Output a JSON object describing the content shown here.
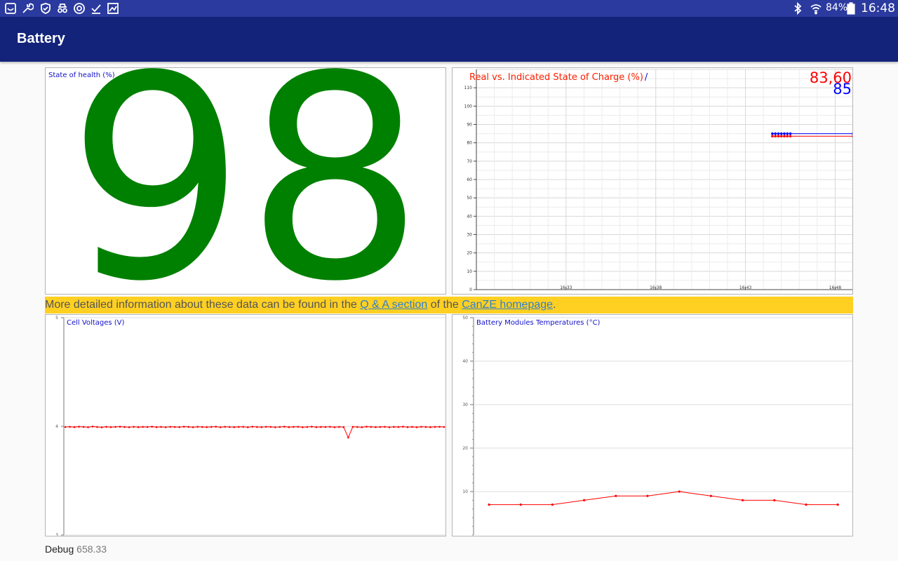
{
  "status_bar": {
    "left_icons": [
      "smile-icon",
      "wrench-icon",
      "shield-icon",
      "spy-icon",
      "sync-icon",
      "check-icon",
      "image-icon"
    ],
    "right_icons": [
      "bluetooth-icon",
      "wifi-icon",
      "battery-icon"
    ],
    "battery_percent": "84%",
    "time": "16:48",
    "color": "#2b3a9e"
  },
  "app_bar": {
    "title": "Battery",
    "color": "#13237a"
  },
  "soh_panel": {
    "title": "State of health (%)",
    "value": "98",
    "value_color": "#008000"
  },
  "soc_panel": {
    "title": "Real vs. Indicated State of Charge (%)",
    "separator": "/",
    "real_value": "83,60",
    "indicated_value": "85",
    "real_color": "#ff0000",
    "indicated_color": "#0000ff"
  },
  "info_bar": {
    "text_before": "More detailed information about these data can be found in the ",
    "link1": "Q & A section",
    "text_middle": " of the ",
    "link2": "CanZE homepage",
    "text_after": ".",
    "color": "#ffd022"
  },
  "cell_panel": {
    "title": "Cell Voltages (V)"
  },
  "temp_panel": {
    "title": "Battery Modules Temperatures (°C)"
  },
  "debug": {
    "label": "Debug",
    "value": "658.33"
  },
  "chart_data": [
    {
      "type": "line",
      "title": "Real vs. Indicated State of Charge (%)",
      "ylim": [
        0,
        120
      ],
      "y_ticks": [
        0,
        10,
        20,
        30,
        40,
        50,
        60,
        70,
        80,
        90,
        100,
        110
      ],
      "x_range": [
        "16:28",
        "16:49"
      ],
      "x_ticks": [
        "16:33",
        "16:38",
        "16:43",
        "16:48"
      ],
      "grid": true,
      "series": [
        {
          "color": "#ff0000",
          "x": [
            "16:44:30",
            "16:44:40",
            "16:44:50",
            "16:45:00",
            "16:45:10",
            "16:45:20",
            "16:45:30",
            "16:49:00"
          ],
          "y": [
            83.6,
            83.6,
            83.6,
            83.6,
            83.6,
            83.6,
            83.6,
            83.6
          ]
        },
        {
          "color": "#0000ff",
          "x": [
            "16:44:30",
            "16:44:40",
            "16:44:50",
            "16:45:00",
            "16:45:10",
            "16:45:20",
            "16:45:30",
            "16:49:00"
          ],
          "y": [
            85,
            85,
            85,
            85,
            85,
            85,
            85,
            85
          ]
        }
      ]
    },
    {
      "type": "line",
      "title": "Cell Voltages (V)",
      "ylim": [
        3,
        5
      ],
      "y_ticks": [
        3,
        4,
        5
      ],
      "grid": true,
      "series": [
        {
          "color": "#ff0000",
          "values": [
            3.994,
            3.996,
            3.993,
            3.997,
            3.995,
            3.992,
            3.998,
            3.994,
            3.991,
            3.996,
            3.993,
            3.995,
            3.997,
            3.994,
            3.992,
            3.996,
            3.993,
            3.995,
            3.994,
            3.997,
            3.993,
            3.995,
            3.992,
            3.996,
            3.994,
            3.993,
            3.997,
            3.995,
            3.992,
            3.996,
            3.994,
            3.993,
            3.995,
            3.997,
            3.992,
            3.996,
            3.994,
            3.993,
            3.995,
            3.996,
            3.992,
            3.997,
            3.994,
            3.993,
            3.996,
            3.995,
            3.992,
            3.994,
            3.997,
            3.993,
            3.995,
            3.996,
            3.992,
            3.994,
            3.997,
            3.993,
            3.995,
            3.994,
            3.996,
            3.992,
            3.995,
            3.993,
            3.897,
            3.996,
            3.994,
            3.992,
            3.997,
            3.995,
            3.993,
            3.994,
            3.996,
            3.992,
            3.995,
            3.994,
            3.997,
            3.993,
            3.995,
            3.992,
            3.996,
            3.994,
            3.993,
            3.995,
            3.996,
            3.994
          ]
        }
      ]
    },
    {
      "type": "line",
      "title": "Battery Modules Temperatures (°C)",
      "ylim": [
        0,
        50
      ],
      "y_ticks": [
        10,
        20,
        30,
        40,
        50
      ],
      "grid": true,
      "series": [
        {
          "color": "#ff0000",
          "values": [
            7,
            7,
            7,
            8,
            9,
            9,
            10,
            9,
            8,
            8,
            7,
            7
          ]
        }
      ]
    }
  ]
}
